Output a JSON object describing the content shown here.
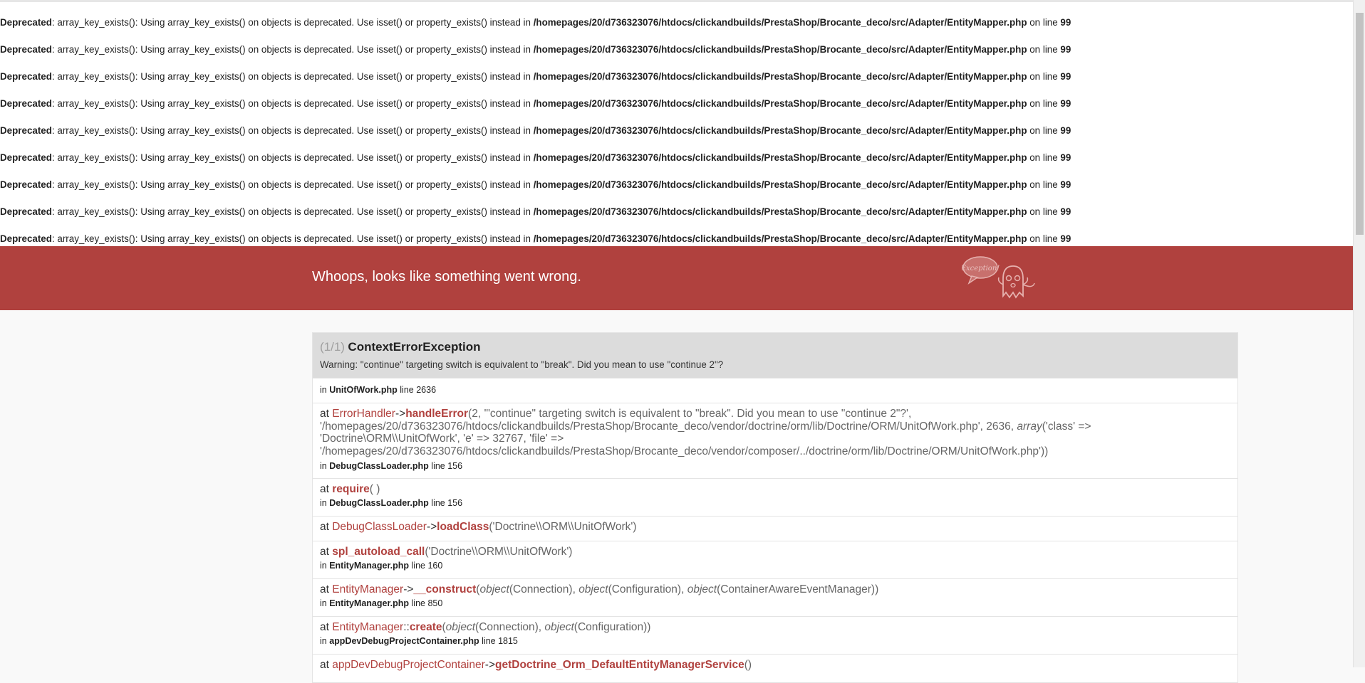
{
  "notices": [
    {
      "level": "Deprecated",
      "text": ": array_key_exists(): Using array_key_exists() on objects is deprecated. Use isset() or property_exists() instead in ",
      "path": "/homepages/20/d736323076/htdocs/clickandbuilds/PrestaShop/Brocante_deco/src/Adapter/EntityMapper.php",
      "online": " on line ",
      "line": "99"
    },
    {
      "level": "Deprecated",
      "text": ": array_key_exists(): Using array_key_exists() on objects is deprecated. Use isset() or property_exists() instead in ",
      "path": "/homepages/20/d736323076/htdocs/clickandbuilds/PrestaShop/Brocante_deco/src/Adapter/EntityMapper.php",
      "online": " on line ",
      "line": "99"
    },
    {
      "level": "Deprecated",
      "text": ": array_key_exists(): Using array_key_exists() on objects is deprecated. Use isset() or property_exists() instead in ",
      "path": "/homepages/20/d736323076/htdocs/clickandbuilds/PrestaShop/Brocante_deco/src/Adapter/EntityMapper.php",
      "online": " on line ",
      "line": "99"
    },
    {
      "level": "Deprecated",
      "text": ": array_key_exists(): Using array_key_exists() on objects is deprecated. Use isset() or property_exists() instead in ",
      "path": "/homepages/20/d736323076/htdocs/clickandbuilds/PrestaShop/Brocante_deco/src/Adapter/EntityMapper.php",
      "online": " on line ",
      "line": "99"
    },
    {
      "level": "Deprecated",
      "text": ": array_key_exists(): Using array_key_exists() on objects is deprecated. Use isset() or property_exists() instead in ",
      "path": "/homepages/20/d736323076/htdocs/clickandbuilds/PrestaShop/Brocante_deco/src/Adapter/EntityMapper.php",
      "online": " on line ",
      "line": "99"
    },
    {
      "level": "Deprecated",
      "text": ": array_key_exists(): Using array_key_exists() on objects is deprecated. Use isset() or property_exists() instead in ",
      "path": "/homepages/20/d736323076/htdocs/clickandbuilds/PrestaShop/Brocante_deco/src/Adapter/EntityMapper.php",
      "online": " on line ",
      "line": "99"
    },
    {
      "level": "Deprecated",
      "text": ": array_key_exists(): Using array_key_exists() on objects is deprecated. Use isset() or property_exists() instead in ",
      "path": "/homepages/20/d736323076/htdocs/clickandbuilds/PrestaShop/Brocante_deco/src/Adapter/EntityMapper.php",
      "online": " on line ",
      "line": "99"
    },
    {
      "level": "Deprecated",
      "text": ": array_key_exists(): Using array_key_exists() on objects is deprecated. Use isset() or property_exists() instead in ",
      "path": "/homepages/20/d736323076/htdocs/clickandbuilds/PrestaShop/Brocante_deco/src/Adapter/EntityMapper.php",
      "online": " on line ",
      "line": "99"
    },
    {
      "level": "Deprecated",
      "text": ": array_key_exists(): Using array_key_exists() on objects is deprecated. Use isset() or property_exists() instead in ",
      "path": "/homepages/20/d736323076/htdocs/clickandbuilds/PrestaShop/Brocante_deco/src/Adapter/EntityMapper.php",
      "online": " on line ",
      "line": "99"
    }
  ],
  "banner": {
    "title": "Whoops, looks like something went wrong.",
    "ghost_bubble": "Exception!",
    "color": "#b0413e"
  },
  "exception": {
    "count": "(1/1)",
    "name": "ContextErrorException",
    "message": "Warning: \"continue\" targeting switch is equivalent to \"break\". Did you mean to use \"continue 2\"?"
  },
  "trace": {
    "r0": {
      "in_file": "UnitOfWork.php",
      "in_line": "line 2636"
    },
    "r1": {
      "at": "at ",
      "cls": "ErrorHandler",
      "sep": "->",
      "fn": "handleError",
      "args_a": "(2, '\"continue\" targeting switch is equivalent to \"break\". Did you mean to use \"continue 2\"?',",
      "args_b": "'/homepages/20/d736323076/htdocs/clickandbuilds/PrestaShop/Brocante_deco/vendor/doctrine/orm/lib/Doctrine/ORM/UnitOfWork.php', 2636, ",
      "args_array": "array",
      "args_c": "('class' =>",
      "args_d": "'Doctrine\\ORM\\\\UnitOfWork', 'e' => 32767, 'file' =>",
      "args_e": "'/homepages/20/d736323076/htdocs/clickandbuilds/PrestaShop/Brocante_deco/vendor/composer/../doctrine/orm/lib/Doctrine/ORM/UnitOfWork.php'))",
      "in_file": "DebugClassLoader.php",
      "in_line": "line 156"
    },
    "r2": {
      "at": "at ",
      "fn": "require",
      "args": "( )",
      "in_file": "DebugClassLoader.php",
      "in_line": "line 156"
    },
    "r3": {
      "at": "at ",
      "cls": "DebugClassLoader",
      "sep": "->",
      "fn": "loadClass",
      "args": "('Doctrine\\\\ORM\\\\UnitOfWork')"
    },
    "r4": {
      "at": "at ",
      "fn": "spl_autoload_call",
      "args": "('Doctrine\\\\ORM\\\\UnitOfWork')",
      "in_file": "EntityManager.php",
      "in_line": "line 160"
    },
    "r5": {
      "at": "at ",
      "cls": "EntityManager",
      "sep": "->",
      "fn": "__construct",
      "obj": "object",
      "a1": "(Connection), ",
      "a2": "(Configuration), ",
      "a3": "(ContainerAwareEventManager))",
      "in_file": "EntityManager.php",
      "in_line": "line 850"
    },
    "r6": {
      "at": "at ",
      "cls": "EntityManager",
      "sep": "::",
      "fn": "create",
      "obj": "object",
      "a1": "(Connection), ",
      "a2": "(Configuration))",
      "in_file": "appDevDebugProjectContainer.php",
      "in_line": "line 1815"
    },
    "r7": {
      "at": "at ",
      "cls": "appDevDebugProjectContainer",
      "sep": "->",
      "fn": "getDoctrine_Orm_DefaultEntityManagerService",
      "args": "()"
    }
  },
  "in_prefix": "in "
}
